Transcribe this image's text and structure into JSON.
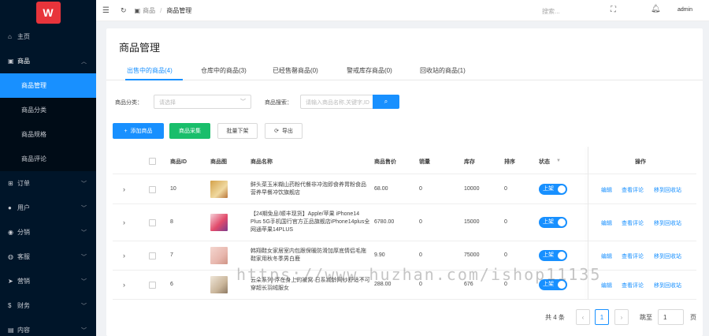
{
  "sidebar": {
    "logo_text": "W",
    "items": [
      {
        "label": "主页",
        "icon": "home-icon"
      },
      {
        "label": "商品",
        "icon": "shop-icon",
        "open": true
      },
      {
        "label": "订单",
        "icon": "cart-icon"
      },
      {
        "label": "用户",
        "icon": "user-icon"
      },
      {
        "label": "分销",
        "icon": "distribution-icon"
      },
      {
        "label": "客服",
        "icon": "service-icon"
      },
      {
        "label": "营销",
        "icon": "marketing-icon"
      },
      {
        "label": "财务",
        "icon": "finance-icon"
      },
      {
        "label": "内容",
        "icon": "content-icon"
      }
    ],
    "subitems": [
      "商品管理",
      "商品分类",
      "商品规格",
      "商品评论"
    ]
  },
  "header": {
    "breadcrumb_1": "商品",
    "breadcrumb_sep": "/",
    "breadcrumb_2": "商品管理",
    "search_placeholder": "搜索...",
    "username": "admin"
  },
  "page": {
    "title": "商品管理",
    "tabs": [
      "出售中的商品(4)",
      "仓库中的商品(3)",
      "已经售罄商品(0)",
      "警戒库存商品(0)",
      "回收站的商品(1)"
    ]
  },
  "filters": {
    "category_label": "商品分类：",
    "category_placeholder": "请选择",
    "search_label": "商品搜索：",
    "search_placeholder": "请输入商品名称,关键字,ID"
  },
  "buttons": {
    "add": "添加商品",
    "collect": "商品采集",
    "batch_off": "批量下架",
    "export": "导出"
  },
  "table": {
    "columns": [
      "商品ID",
      "商品图",
      "商品名称",
      "商品售价",
      "销量",
      "库存",
      "排序",
      "状态",
      "操作"
    ],
    "rows": [
      {
        "id": "10",
        "name": "鲜头菜玉米糊山药粉代餐非冲泡即食养胃粉食品营养早餐冲饮旗舰店",
        "price": "68.00",
        "sales": "0",
        "stock": "10000",
        "sort": "0",
        "status": "上架"
      },
      {
        "id": "8",
        "name": "【24期免息/顺丰现货】Apple/苹果 iPhone14 Plus 5G手机国行官方正品旗舰店iPhone14plus全网通苹果14PLUS",
        "price": "6780.00",
        "sales": "0",
        "stock": "15000",
        "sort": "0",
        "status": "上架"
      },
      {
        "id": "7",
        "name": "韩翔鞋女家居室内包跟保暖防滑加厚底情侣毛拖鞋家用秋冬季男白鹿",
        "price": "9.90",
        "sales": "0",
        "stock": "75000",
        "sort": "0",
        "status": "上架"
      },
      {
        "id": "6",
        "name": "云朵系列·浮在身上的被窝·日系减龄网纱舒适不可穿超长羽绒服女",
        "price": "288.00",
        "sales": "0",
        "stock": "676",
        "sort": "0",
        "status": "上架"
      }
    ],
    "actions": [
      "编辑",
      "查看评论",
      "移到回收站"
    ]
  },
  "pagination": {
    "total": "共 4 条",
    "current": "1",
    "goto": "跳至",
    "goto_value": "1",
    "page_unit": "页"
  },
  "watermark": "https://www.huzhan.com/ishop11135",
  "colors": {
    "primary": "#1890ff",
    "success": "#19be6b",
    "sidebar": "#001529"
  }
}
